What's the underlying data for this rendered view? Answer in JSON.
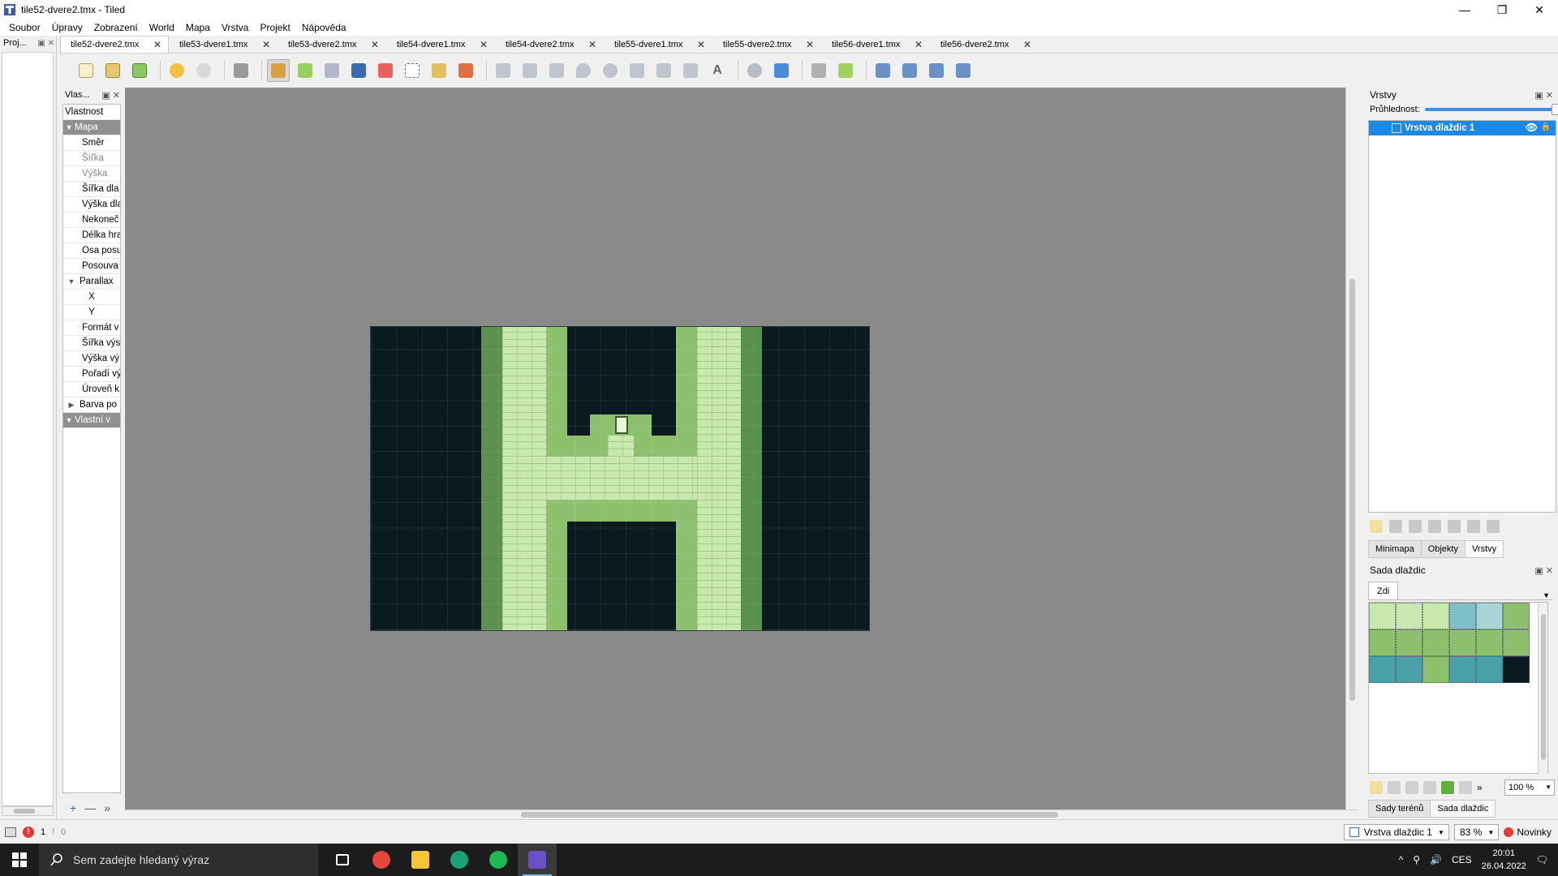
{
  "window": {
    "title": "tile52-dvere2.tmx - Tiled",
    "buttons": [
      "—",
      "❐",
      "✕"
    ]
  },
  "menu": [
    {
      "label": "Soubor"
    },
    {
      "label": "Úpravy"
    },
    {
      "label": "Zobrazení"
    },
    {
      "label": "World"
    },
    {
      "label": "Mapa"
    },
    {
      "label": "Vrstva"
    },
    {
      "label": "Projekt"
    },
    {
      "label": "Nápověda"
    }
  ],
  "projects_dock": {
    "title": "Proj...",
    "buttons": "▣ ✕"
  },
  "tabs": [
    {
      "label": "tile52-dvere2.tmx",
      "active": true
    },
    {
      "label": "tile53-dvere1.tmx"
    },
    {
      "label": "tile53-dvere2.tmx"
    },
    {
      "label": "tile54-dvere1.tmx"
    },
    {
      "label": "tile54-dvere2.tmx"
    },
    {
      "label": "tile55-dvere1.tmx"
    },
    {
      "label": "tile55-dvere2.tmx"
    },
    {
      "label": "tile56-dvere1.tmx"
    },
    {
      "label": "tile56-dvere2.tmx"
    }
  ],
  "tab_close": "✕",
  "properties": {
    "title": "Vlas...",
    "buttons": "▣ ✕",
    "header": "Vlastnost",
    "rows": [
      {
        "label": "Mapa",
        "kind": "group",
        "arrow": "▼"
      },
      {
        "label": "Směr",
        "kind": "sub"
      },
      {
        "label": "Šířka",
        "kind": "sub-disabled"
      },
      {
        "label": "Výška",
        "kind": "sub-disabled"
      },
      {
        "label": "Šířka dla",
        "kind": "sub"
      },
      {
        "label": "Výška dla",
        "kind": "sub"
      },
      {
        "label": "Nekoneč",
        "kind": "sub"
      },
      {
        "label": "Délka hra",
        "kind": "sub"
      },
      {
        "label": "Osa posu",
        "kind": "sub"
      },
      {
        "label": "Posouva",
        "kind": "sub"
      },
      {
        "label": "Parallax",
        "kind": "groupw",
        "arrow": "▼"
      },
      {
        "label": "X",
        "kind": "center"
      },
      {
        "label": "Y",
        "kind": "center"
      },
      {
        "label": "Formát v",
        "kind": "sub"
      },
      {
        "label": "Šířka výs",
        "kind": "sub"
      },
      {
        "label": "Výška vý",
        "kind": "sub"
      },
      {
        "label": "Pořadí vý",
        "kind": "sub"
      },
      {
        "label": "Úroveň k",
        "kind": "sub"
      },
      {
        "label": "Barva po",
        "kind": "groupw",
        "arrow": "▶"
      },
      {
        "label": "Vlastní v",
        "kind": "group",
        "arrow": "▼"
      }
    ],
    "bottom_buttons": {
      "add": "+",
      "remove": "—",
      "more": "»"
    }
  },
  "layers_panel": {
    "title": "Vrstvy",
    "buttons": "▣ ✕",
    "opacity_label": "Průhlednost:",
    "opacity_value": 1.0,
    "layer": {
      "name": "Vrstva dlaždic 1",
      "eye": "👁",
      "lock": "🔒"
    },
    "tabs": [
      {
        "label": "Minimapa"
      },
      {
        "label": "Objekty"
      },
      {
        "label": "Vrstvy",
        "active": true
      }
    ]
  },
  "tileset_panel": {
    "title": "Sada dlaždic",
    "buttons": "▣ ✕",
    "tileset_tab": "Zdi",
    "more": "»",
    "zoom": "100 %",
    "tabs": [
      {
        "label": "Sady terénů"
      },
      {
        "label": "Sada dlaždic",
        "active": true
      }
    ],
    "tile_colors": [
      "#c8e8b0",
      "#c8e8b0",
      "#c8e8b0",
      "#7ec0c8",
      "#a8d4d8",
      "#8cc06c",
      "#8cc06c",
      "#8cc06c",
      "#8cc06c",
      "#8cc06c",
      "#8cc06c",
      "#8cc06c",
      "#4aa0a8",
      "#4aa0a8",
      "#8cc06c",
      "#4aa0a8",
      "#4aa0a8",
      "#0a1a20"
    ]
  },
  "status_bar": {
    "error_count": "1",
    "warning_icon": "!",
    "warning_count": "0",
    "layer_combo": "Vrstva dlaždic 1",
    "zoom_combo": "83 %",
    "news": "Novinky"
  },
  "taskbar": {
    "search_placeholder": "Sem zadejte hledaný výraz",
    "apps": [
      {
        "name": "task-view",
        "color": "#1c1c1c"
      },
      {
        "name": "chrome",
        "color": "#e8453c"
      },
      {
        "name": "explorer",
        "color": "#f8c537"
      },
      {
        "name": "app-green",
        "color": "#1aa37a"
      },
      {
        "name": "spotify",
        "color": "#1db954"
      },
      {
        "name": "tiled",
        "color": "#6a4fc8",
        "active": true
      }
    ],
    "language": "CES",
    "time": "20:01",
    "date": "26.04.2022"
  }
}
